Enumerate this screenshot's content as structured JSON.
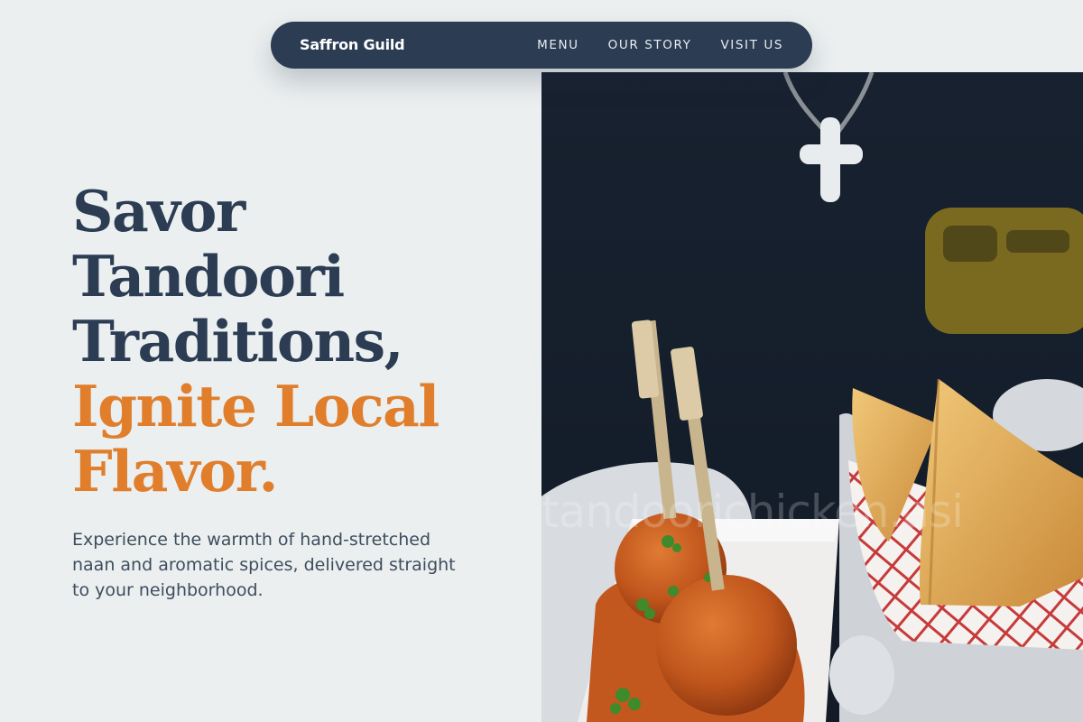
{
  "nav": {
    "brand": "Saffron Guild",
    "links": [
      "MENU",
      "OUR STORY",
      "VISIT US"
    ]
  },
  "hero": {
    "title_dark": [
      "Savor",
      "Tandoori",
      "Traditions,"
    ],
    "title_accent": [
      "Ignite Local",
      "Flavor."
    ],
    "subtitle": "Experience the warmth of hand-stretched naan and aromatic spices, delivered straight to your neighborhood."
  },
  "photo": {
    "watermark": "tandoorichicken.asi"
  },
  "colors": {
    "background": "#ebeff0",
    "navy": "#2b3c53",
    "accent": "#e07e2c",
    "body_text": "#3e4d5e"
  }
}
